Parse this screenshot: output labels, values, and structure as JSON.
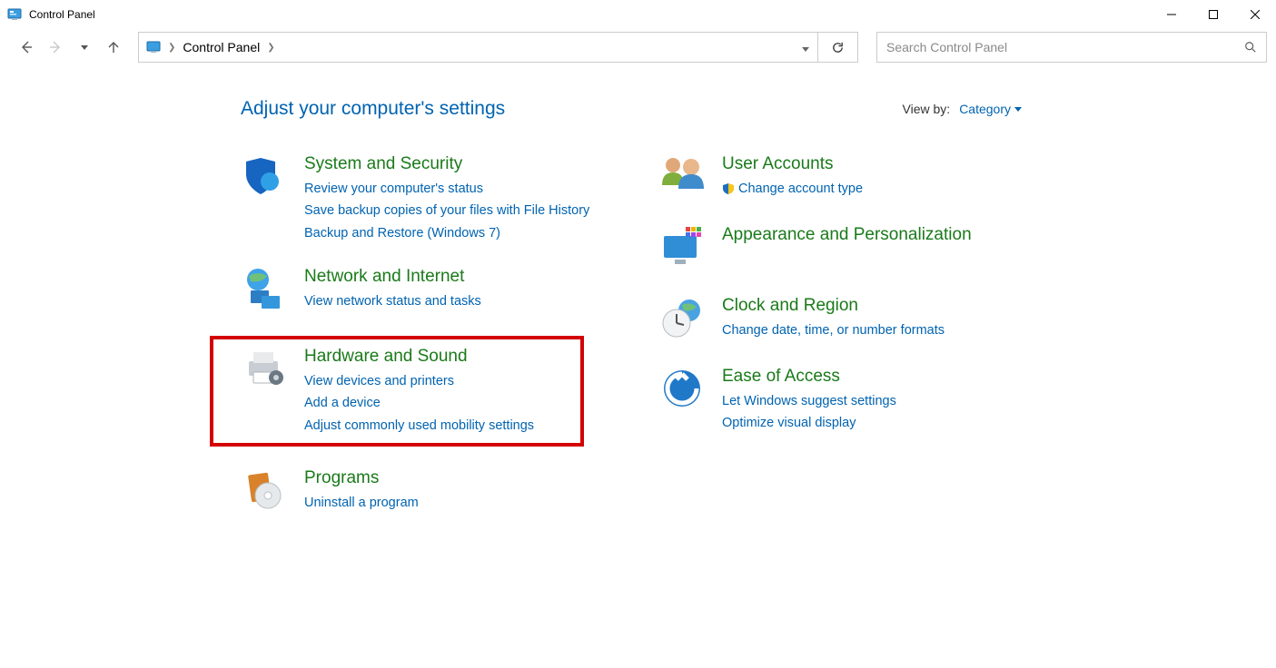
{
  "window": {
    "title": "Control Panel"
  },
  "address": {
    "crumb": "Control Panel"
  },
  "search": {
    "placeholder": "Search Control Panel"
  },
  "heading": "Adjust your computer's settings",
  "viewby": {
    "label": "View by:",
    "value": "Category"
  },
  "left": [
    {
      "title": "System and Security",
      "links": [
        "Review your computer's status",
        "Save backup copies of your files with File History",
        "Backup and Restore (Windows 7)"
      ]
    },
    {
      "title": "Network and Internet",
      "links": [
        "View network status and tasks"
      ]
    },
    {
      "title": "Hardware and Sound",
      "links": [
        "View devices and printers",
        "Add a device",
        "Adjust commonly used mobility settings"
      ],
      "highlight": true
    },
    {
      "title": "Programs",
      "links": [
        "Uninstall a program"
      ]
    }
  ],
  "right": [
    {
      "title": "User Accounts",
      "links": [
        {
          "text": "Change account type",
          "shield": true
        }
      ]
    },
    {
      "title": "Appearance and Personalization",
      "links": []
    },
    {
      "title": "Clock and Region",
      "links": [
        "Change date, time, or number formats"
      ]
    },
    {
      "title": "Ease of Access",
      "links": [
        "Let Windows suggest settings",
        "Optimize visual display"
      ]
    }
  ]
}
